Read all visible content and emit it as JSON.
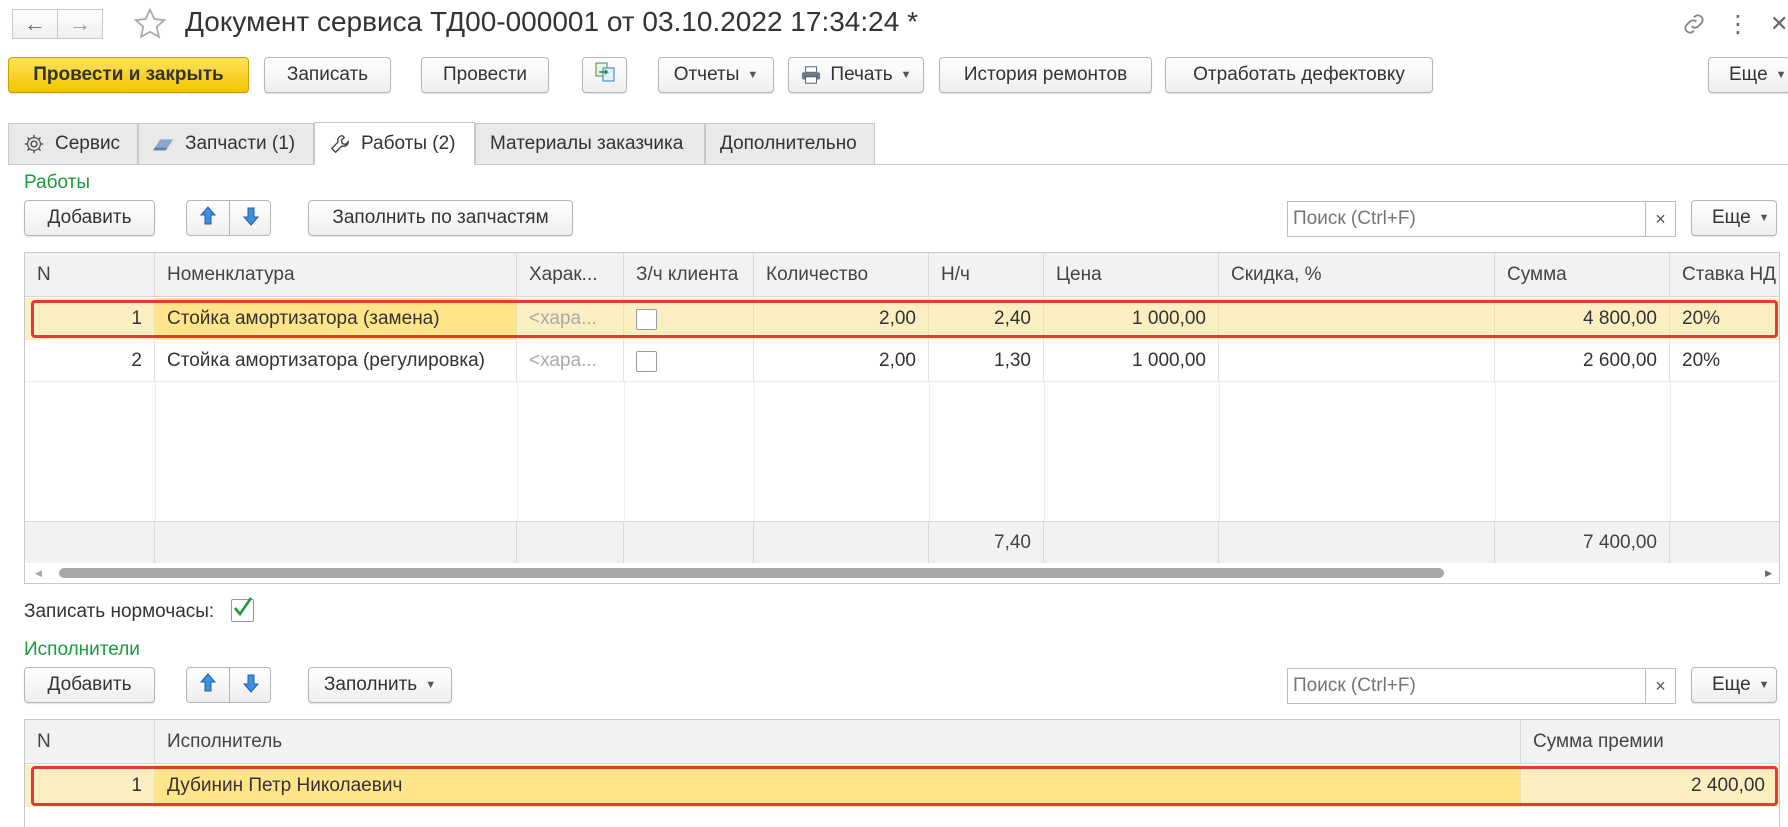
{
  "window": {
    "title": "Документ сервиса ТД00-000001 от 03.10.2022 17:34:24 *"
  },
  "toolbar": {
    "post_and_close": "Провести и закрыть",
    "save": "Записать",
    "post": "Провести",
    "reports": "Отчеты",
    "print": "Печать",
    "repair_history": "История ремонтов",
    "process_defects": "Отработать дефектовку",
    "more": "Еще"
  },
  "tabs": [
    {
      "label": "Сервис",
      "icon": "gear-icon"
    },
    {
      "label": "Запчасти (1)",
      "icon": "parts-icon"
    },
    {
      "label": "Работы (2)",
      "icon": "wrench-icon",
      "active": true
    },
    {
      "label": "Материалы заказчика"
    },
    {
      "label": "Дополнительно"
    }
  ],
  "works": {
    "section_label": "Работы",
    "add": "Добавить",
    "fill_by_parts": "Заполнить по запчастям",
    "search_placeholder": "Поиск (Ctrl+F)",
    "search_clear": "×",
    "more": "Еще",
    "columns": [
      "N",
      "Номенклатура",
      "Харак...",
      "З/ч клиента",
      "Количество",
      "Н/ч",
      "Цена",
      "Скидка, %",
      "Сумма",
      "Ставка НД"
    ],
    "rows": [
      {
        "n": "1",
        "item": "Стойка амортизатора (замена)",
        "char": "<хара...",
        "client_part": false,
        "qty": "2,00",
        "hours": "2,40",
        "price": "1 000,00",
        "discount": "",
        "sum": "4 800,00",
        "vat": "20%",
        "selected": true
      },
      {
        "n": "2",
        "item": "Стойка амортизатора (регулировка)",
        "char": "<хара...",
        "client_part": false,
        "qty": "2,00",
        "hours": "1,30",
        "price": "1 000,00",
        "discount": "",
        "sum": "2 600,00",
        "vat": "20%",
        "selected": false
      }
    ],
    "totals": {
      "hours": "7,40",
      "sum": "7 400,00"
    }
  },
  "norm_hours": {
    "label": "Записать нормочасы:",
    "checked": true
  },
  "executors": {
    "section_label": "Исполнители",
    "add": "Добавить",
    "fill": "Заполнить",
    "search_placeholder": "Поиск (Ctrl+F)",
    "search_clear": "×",
    "more": "Еще",
    "columns": [
      "N",
      "Исполнитель",
      "Сумма премии"
    ],
    "rows": [
      {
        "n": "1",
        "executor": "Дубинин Петр Николаевич",
        "bonus": "2 400,00",
        "selected": true
      }
    ]
  },
  "colors": {
    "primary_button": "#f4c400",
    "section_label": "#1a9a3e",
    "selected_row": "#fbeec0",
    "highlight_border": "#e53935"
  }
}
